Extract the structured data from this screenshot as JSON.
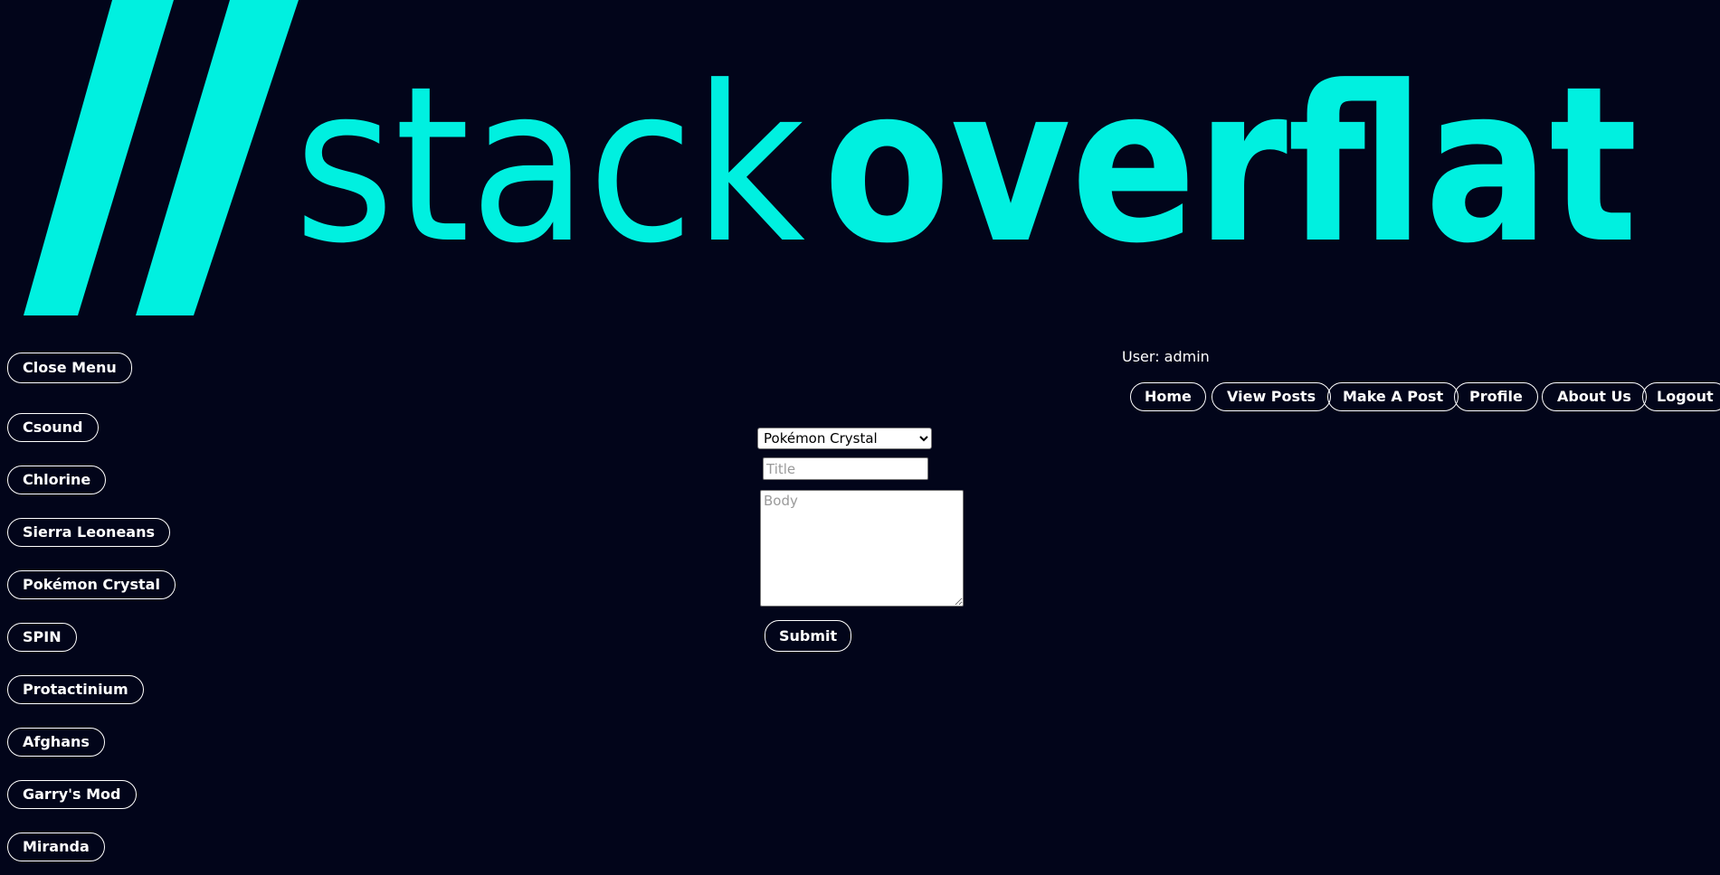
{
  "brand": {
    "light": "stack",
    "bold": "overflat",
    "accent_color": "#00f0e0",
    "background_color": "#02051a"
  },
  "menu": {
    "close_label": "Close Menu",
    "topics": [
      "Csound",
      "Chlorine",
      "Sierra Leoneans",
      "Pokémon Crystal",
      "SPIN",
      "Protactinium",
      "Afghans",
      "Garry's Mod",
      "Miranda"
    ]
  },
  "header": {
    "user_label": "User: admin",
    "nav": {
      "home": "Home",
      "view_posts": "View Posts",
      "make_post": "Make A Post",
      "profile": "Profile",
      "about_us": "About Us",
      "logout": "Logout"
    }
  },
  "form": {
    "topic_selected": "Pokémon Crystal",
    "title_placeholder": "Title",
    "body_placeholder": "Body",
    "submit_label": "Submit"
  }
}
